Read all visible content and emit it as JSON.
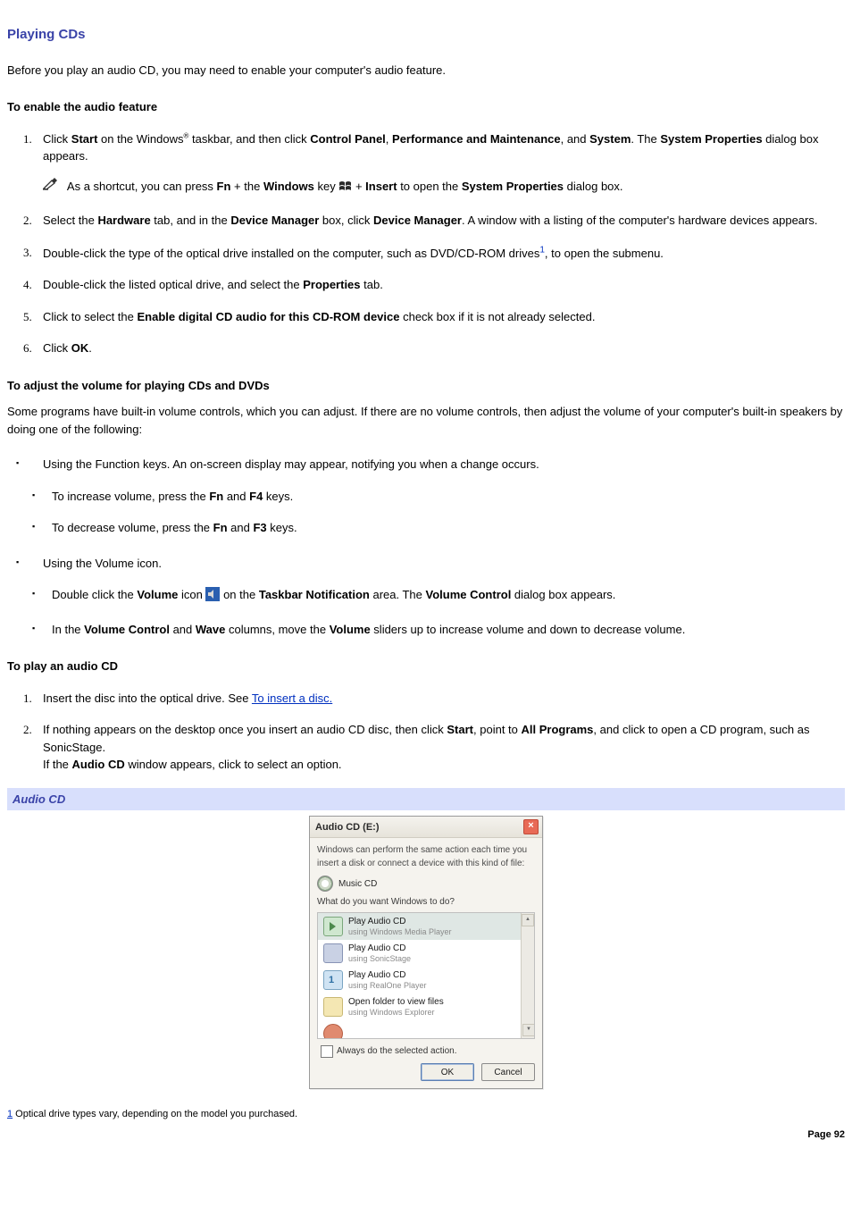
{
  "title": "Playing CDs",
  "intro": "Before you play an audio CD, you may need to enable your computer's audio feature.",
  "section_audio": {
    "heading": "To enable the audio feature",
    "steps": {
      "1": {
        "pre": "Click ",
        "b_start": "Start",
        "mid1": " on the Windows",
        "reg": "®",
        "mid2": " taskbar, and then click ",
        "b_cp": "Control Panel",
        "c1": ", ",
        "b_pm": "Performance and Maintenance",
        "c2": ", and ",
        "b_sys": "System",
        "end": ". The ",
        "b_sp": "System Properties",
        "tail": " dialog box appears."
      },
      "shortcut": {
        "pre": "As a shortcut, you can press ",
        "b_fn": "Fn",
        "plus": " + the ",
        "b_win": "Windows",
        "mid": " key ",
        "plus2": " + ",
        "b_ins": "Insert",
        "end1": " to open the ",
        "b_sp": "System Properties",
        "end2": " dialog box."
      },
      "2": {
        "pre": "Select the ",
        "b_hw": "Hardware",
        "mid1": " tab, and in the ",
        "b_dmg": "Device Manager",
        "mid2": " box, click ",
        "b_dmg2": "Device Manager",
        "end": ". A window with a listing of the computer's hardware devices appears."
      },
      "3": {
        "pre": "Double-click the type of the optical drive installed on the computer, such as DVD/CD-ROM drives",
        "fn": "1",
        "end": ", to open the submenu."
      },
      "4": {
        "pre": "Double-click the listed optical drive, and select the ",
        "b_prop": "Properties",
        "end": " tab."
      },
      "5": {
        "pre": "Click to select the ",
        "b_enable": "Enable digital CD audio for this CD-ROM device",
        "end": " check box if it is not already selected."
      },
      "6": {
        "pre": "Click ",
        "b_ok": "OK",
        "end": "."
      }
    }
  },
  "section_volume": {
    "heading": "To adjust the volume for playing CDs and DVDs",
    "para": "Some programs have built-in volume controls, which you can adjust. If there are no volume controls, then adjust the volume of your computer's built-in speakers by doing one of the following:",
    "bullets": {
      "fnkeys": "Using the Function keys. An on-screen display may appear, notifying you when a change occurs.",
      "inc": {
        "pre": "To increase volume, press the ",
        "b_fn": "Fn",
        "mid": " and ",
        "b_f4": "F4",
        "end": " keys."
      },
      "dec": {
        "pre": "To decrease volume, press the ",
        "b_fn": "Fn",
        "mid": " and ",
        "b_f3": "F3",
        "end": " keys."
      },
      "volicon": "Using the Volume icon.",
      "dbl": {
        "pre": "Double click the ",
        "b_vol": "Volume",
        "mid": " icon ",
        "mid2": " on the ",
        "b_tn": "Taskbar Notification",
        "mid3": " area. The ",
        "b_vc": "Volume Control",
        "end": " dialog box appears."
      },
      "cols": {
        "pre": "In the ",
        "b_vc": "Volume Control",
        "and": " and ",
        "b_wave": "Wave",
        "mid": " columns, move the ",
        "b_vol": "Volume",
        "end": " sliders up to increase volume and down to decrease volume."
      }
    }
  },
  "section_play": {
    "heading": "To play an audio CD",
    "steps": {
      "1": {
        "pre": "Insert the disc into the optical drive. See ",
        "link": "To insert a disc."
      },
      "2": {
        "pre": "If nothing appears on the desktop once you insert an audio CD disc, then click ",
        "b_start": "Start",
        "mid": ", point to ",
        "b_ap": "All Programs",
        "mid2": ", and click to open a CD program, such as SonicStage.",
        "line2a": "If the ",
        "b_ac": "Audio CD",
        "line2b": " window appears, click to select an option."
      }
    }
  },
  "dialog": {
    "caption": "Audio CD",
    "title": "Audio CD (E:)",
    "desc": "Windows can perform the same action each time you insert a disk or connect a device with this kind of file:",
    "media": "Music CD",
    "question": "What do you want Windows to do?",
    "options": [
      {
        "l1": "Play Audio CD",
        "l2": "using Windows Media Player"
      },
      {
        "l1": "Play Audio CD",
        "l2": "using SonicStage"
      },
      {
        "l1": "Play Audio CD",
        "l2": "using RealOne Player"
      },
      {
        "l1": "Open folder to view files",
        "l2": "using Windows Explorer"
      },
      {
        "l1": "",
        "l2": ""
      }
    ],
    "check": "Always do the selected action.",
    "ok": "OK",
    "cancel": "Cancel"
  },
  "footnote": {
    "num": "1",
    "text": " Optical drive types vary, depending on the model you purchased."
  },
  "pagenum": "Page 92"
}
